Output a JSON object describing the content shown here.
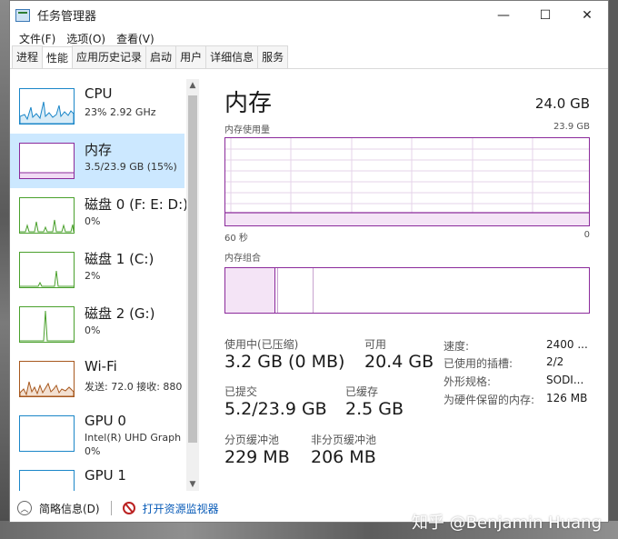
{
  "window": {
    "title": "任务管理器",
    "minimize_glyph": "—",
    "maximize_glyph": "☐",
    "close_glyph": "✕"
  },
  "menu": [
    "文件(F)",
    "选项(O)",
    "查看(V)"
  ],
  "tabs": [
    "进程",
    "性能",
    "应用历史记录",
    "启动",
    "用户",
    "详细信息",
    "服务"
  ],
  "active_tab": "性能",
  "sidebar": {
    "items": [
      {
        "name": "CPU",
        "sub": "23%  2.92 GHz",
        "color": "#1a86c8"
      },
      {
        "name": "内存",
        "sub": "3.5/23.9 GB (15%)",
        "color": "#8b2a9b"
      },
      {
        "name": "磁盘 0 (F: E: D:)",
        "sub": "0%",
        "color": "#4aa02c"
      },
      {
        "name": "磁盘 1 (C:)",
        "sub": "2%",
        "color": "#4aa02c"
      },
      {
        "name": "磁盘 2 (G:)",
        "sub": "0%",
        "color": "#4aa02c"
      },
      {
        "name": "Wi-Fi",
        "sub": "发送: 72.0  接收: 880",
        "color": "#a7581e"
      },
      {
        "name": "GPU 0",
        "sub": "Intel(R) UHD Graph",
        "sub2": "0%",
        "color": "#1a86c8"
      },
      {
        "name": "GPU 1",
        "sub": "",
        "color": "#1a86c8"
      }
    ]
  },
  "main": {
    "title": "内存",
    "total": "24.0 GB",
    "usage_label": "内存使用量",
    "usage_max": "23.9 GB",
    "time_left": "60 秒",
    "time_right": "0",
    "composition_label": "内存组合",
    "accent": "#8b2a9b",
    "stats": {
      "in_use_label": "使用中(已压缩)",
      "in_use_value": "3.2 GB (0 MB)",
      "available_label": "可用",
      "available_value": "20.4 GB",
      "committed_label": "已提交",
      "committed_value": "5.2/23.9 GB",
      "cached_label": "已缓存",
      "cached_value": "2.5 GB",
      "paged_label": "分页缓冲池",
      "paged_value": "229 MB",
      "nonpaged_label": "非分页缓冲池",
      "nonpaged_value": "206 MB"
    },
    "details": [
      {
        "key": "速度:",
        "value": "2400 ..."
      },
      {
        "key": "已使用的插槽:",
        "value": "2/2"
      },
      {
        "key": "外形规格:",
        "value": "SODI..."
      },
      {
        "key": "为硬件保留的内存:",
        "value": "126 MB"
      }
    ]
  },
  "footer": {
    "fewer_details": "简略信息(D)",
    "open_monitor": "打开资源监视器"
  },
  "watermark": "知乎 @Benjamin Huang"
}
